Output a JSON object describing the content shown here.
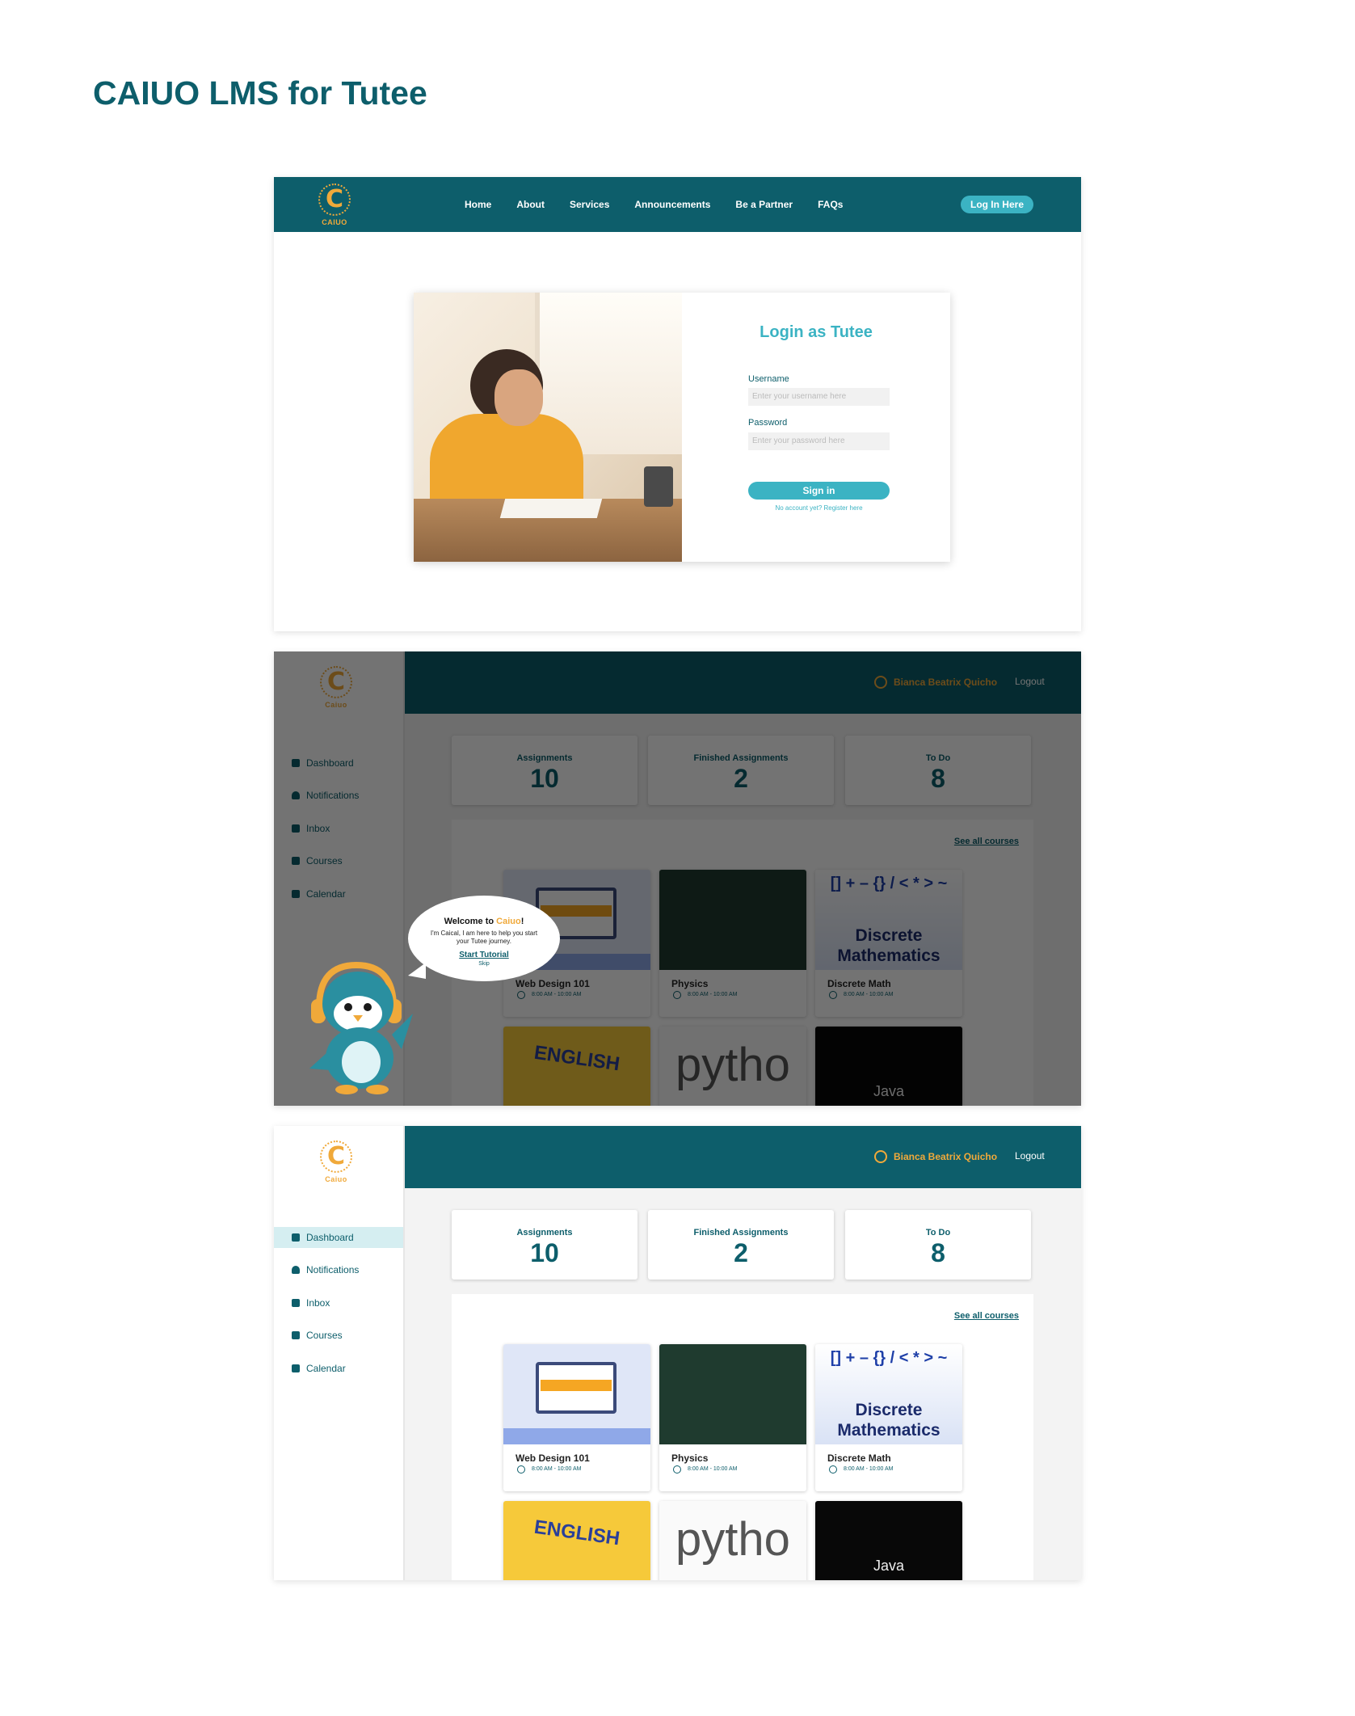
{
  "page_title": "CAIUO LMS for Tutee",
  "brand": {
    "logo_letter": "C",
    "logo_word": "CAIUO",
    "logo_word_small": "Caiuo"
  },
  "login_screen": {
    "nav": [
      "Home",
      "About",
      "Services",
      "Announcements",
      "Be a Partner",
      "FAQs"
    ],
    "login_button": "Log In Here",
    "form": {
      "title": "Login as Tutee",
      "username_label": "Username",
      "username_placeholder": "Enter your username here",
      "password_label": "Password",
      "password_placeholder": "Enter your password here",
      "submit": "Sign in",
      "register_link": "No account yet? Register here"
    }
  },
  "dashboard": {
    "user_name": "Bianca Beatrix Quicho",
    "logout": "Logout",
    "sidebar": [
      {
        "label": "Dashboard",
        "icon": "dashboard-icon"
      },
      {
        "label": "Notifications",
        "icon": "bell-icon"
      },
      {
        "label": "Inbox",
        "icon": "inbox-icon"
      },
      {
        "label": "Courses",
        "icon": "book-icon"
      },
      {
        "label": "Calendar",
        "icon": "calendar-icon"
      }
    ],
    "stats": [
      {
        "label": "Assignments",
        "value": "10"
      },
      {
        "label": "Finished Assignments",
        "value": "2"
      },
      {
        "label": "To Do",
        "value": "8"
      }
    ],
    "see_all": "See all courses",
    "courses": [
      {
        "name": "Web Design 101",
        "time": "8:00 AM - 10:00 AM"
      },
      {
        "name": "Physics",
        "time": "8:00 AM - 10:00 AM"
      },
      {
        "name": "Discrete Math",
        "time": "8:00 AM - 10:00 AM"
      },
      {
        "name": "English",
        "time": ""
      },
      {
        "name": "Python",
        "time": ""
      },
      {
        "name": "Java",
        "time": ""
      }
    ],
    "thumb_text": {
      "discrete_line1": "Discrete",
      "discrete_line2": "Mathematics",
      "discrete_symbols": "[] + – {}  / < * > ~",
      "english": "ENGLISH",
      "python": "pytho",
      "java": "Java"
    }
  },
  "tutorial_bubble": {
    "title_prefix": "Welcome to ",
    "title_brand": "Caiuo",
    "title_suffix": "!",
    "text": "I'm Caical, I am here to help you start your Tutee journey.",
    "start": "Start Tutorial",
    "skip": "Skip"
  }
}
